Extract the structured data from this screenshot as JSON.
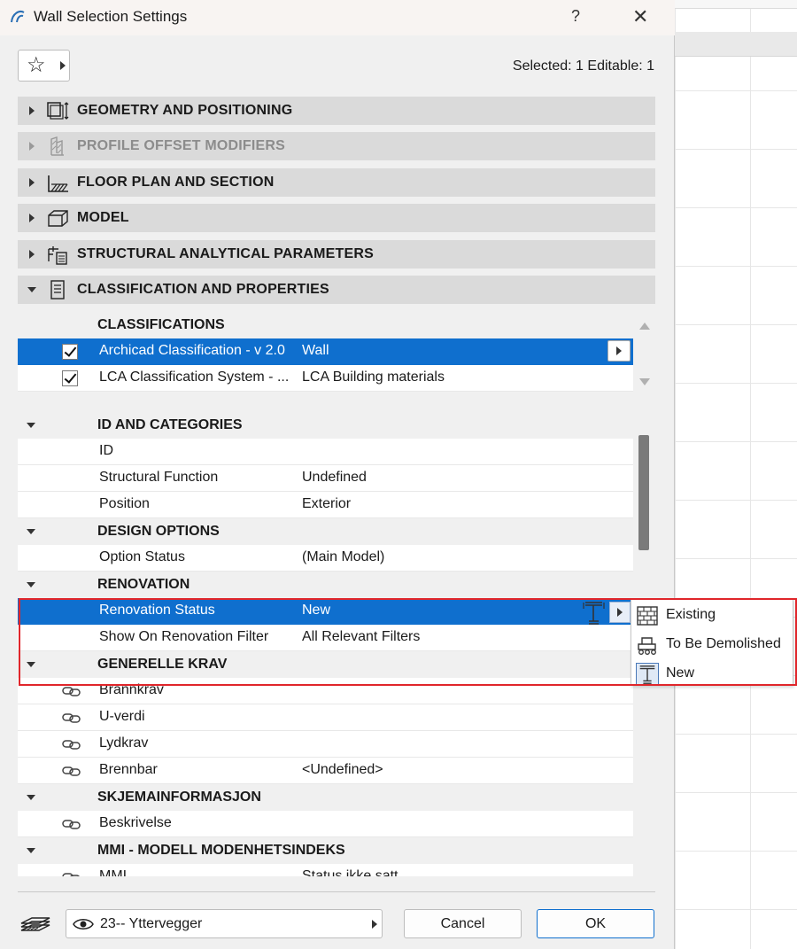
{
  "window": {
    "title": "Wall Selection Settings",
    "help": "?",
    "close": "✕"
  },
  "header": {
    "selected_info": "Selected: 1 Editable: 1"
  },
  "panels": [
    {
      "label": "GEOMETRY AND POSITIONING",
      "state": "collapsed"
    },
    {
      "label": "PROFILE OFFSET MODIFIERS",
      "state": "collapsed-disabled"
    },
    {
      "label": "FLOOR PLAN AND SECTION",
      "state": "collapsed"
    },
    {
      "label": "MODEL",
      "state": "collapsed"
    },
    {
      "label": "STRUCTURAL ANALYTICAL PARAMETERS",
      "state": "collapsed"
    },
    {
      "label": "CLASSIFICATION AND PROPERTIES",
      "state": "expanded"
    }
  ],
  "classifications": {
    "header": "CLASSIFICATIONS",
    "rows": [
      {
        "name": "Archicad Classification - v 2.0",
        "value": "Wall",
        "checked": true,
        "selected": true
      },
      {
        "name": "LCA Classification System - ...",
        "value": "LCA Building materials",
        "checked": true,
        "selected": false
      }
    ]
  },
  "properties": {
    "groups": [
      {
        "label": "ID AND CATEGORIES",
        "rows": [
          {
            "name": "ID",
            "value": ""
          },
          {
            "name": "Structural Function",
            "value": "Undefined"
          },
          {
            "name": "Position",
            "value": "Exterior"
          }
        ]
      },
      {
        "label": "DESIGN OPTIONS",
        "rows": [
          {
            "name": "Option Status",
            "value": "(Main Model)"
          }
        ]
      },
      {
        "label": "RENOVATION",
        "rows": [
          {
            "name": "Renovation Status",
            "value": "New"
          },
          {
            "name": "Show On Renovation Filter",
            "value": "All Relevant Filters"
          }
        ]
      },
      {
        "label": "GENERELLE KRAV",
        "rows": [
          {
            "name": "Brannkrav",
            "value": ""
          },
          {
            "name": "U-verdi",
            "value": ""
          },
          {
            "name": "Lydkrav",
            "value": ""
          },
          {
            "name": "Brennbar",
            "value": "<Undefined>"
          }
        ]
      },
      {
        "label": "SKJEMAINFORMASJON",
        "rows": [
          {
            "name": "Beskrivelse",
            "value": ""
          }
        ]
      },
      {
        "label": "MMI - MODELL MODENHETSINDEKS",
        "rows": [
          {
            "name": "MMI",
            "value": "Status ikke satt"
          }
        ]
      }
    ]
  },
  "renovation_menu": {
    "items": [
      {
        "label": "Existing",
        "icon": "brick-wall-icon"
      },
      {
        "label": "To Be Demolished",
        "icon": "demolish-icon"
      },
      {
        "label": "New",
        "icon": "new-construction-icon",
        "current": true
      }
    ]
  },
  "footer": {
    "layer_value": "23-- Yttervegger",
    "cancel_label": "Cancel",
    "ok_label": "OK"
  },
  "colors": {
    "selection_blue": "#0f6fce",
    "highlight_red": "#e0262b",
    "panel_header_gray": "#dadada"
  }
}
